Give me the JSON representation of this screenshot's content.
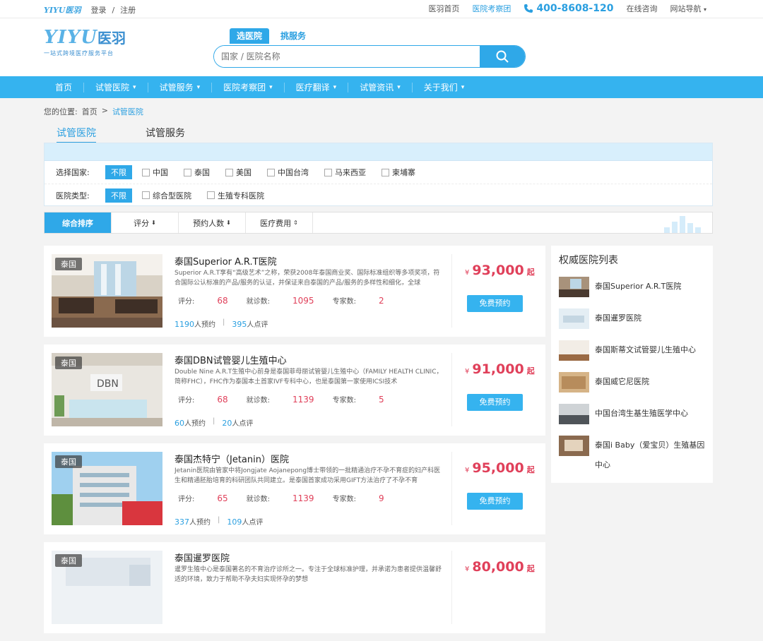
{
  "topbar": {
    "mini_logo": "YIYU医羽",
    "login": "登录",
    "sep": "/",
    "register": "注册",
    "links": [
      "医羽首页",
      "医院考察团"
    ],
    "phone": "400-8608-120",
    "online": "在线咨询",
    "sitenav": "网站导航"
  },
  "logo": {
    "en": "YIYU",
    "cn": "医羽",
    "sub": "一站式跨境医疗服务平台"
  },
  "search": {
    "tab_active": "选医院",
    "tab_other": "挑服务",
    "placeholder": "国家 / 医院名称"
  },
  "nav": [
    "首页",
    "试管医院",
    "试管服务",
    "医院考察团",
    "医疗翻译",
    "试管资讯",
    "关于我们"
  ],
  "breadcrumb": {
    "label": "您的位置:",
    "home": "首页",
    "arrow": ">",
    "current": "试管医院"
  },
  "page_tabs": [
    "试管医院",
    "试管服务"
  ],
  "filters": {
    "country_label": "选择国家:",
    "unlimited": "不限",
    "countries": [
      "中国",
      "泰国",
      "美国",
      "中国台湾",
      "马来西亚",
      "柬埔寨"
    ],
    "type_label": "医院类型:",
    "types": [
      "综合型医院",
      "生殖专科医院"
    ]
  },
  "sort": [
    "综合排序",
    "评分",
    "预约人数",
    "医疗费用"
  ],
  "hospitals": [
    {
      "tag": "泰国",
      "name": "泰国Superior A.R.T医院",
      "desc": "Superior A.R.T享有“高级艺术”之称，荣获2008年泰国商业奖、国际标准组织等多项奖项，符合国际公认标准的产品/服务的认证，并保证来自泰国的产品/服务的多样性和细化，全球",
      "score_label": "评分:",
      "score": "68",
      "visits_label": "就诊数:",
      "visits": "1095",
      "experts_label": "专家数:",
      "experts": "2",
      "bookings": "1190",
      "bookings_suffix": "人预约",
      "reviews": "395",
      "reviews_suffix": "人点评",
      "currency": "¥",
      "price": "93,000",
      "price_suffix": "起",
      "book_label": "免费预约"
    },
    {
      "tag": "泰国",
      "name": "泰国DBN试管婴儿生殖中心",
      "desc": "Double Nine A.R.T生殖中心前身是泰国菲母丽试管婴儿生殖中心（FAMILY HEALTH CLINIC，简称FHC），FHC作为泰国本土首家IVF专科中心，也是泰国第一家使用ICSI技术",
      "score_label": "评分:",
      "score": "68",
      "visits_label": "就诊数:",
      "visits": "1139",
      "experts_label": "专家数:",
      "experts": "5",
      "bookings": "60",
      "bookings_suffix": "人预约",
      "reviews": "20",
      "reviews_suffix": "人点评",
      "currency": "¥",
      "price": "91,000",
      "price_suffix": "起",
      "book_label": "免费预约"
    },
    {
      "tag": "泰国",
      "name": "泰国杰特宁（Jetanin）医院",
      "desc": "Jetanin医院由管家中将Jongjate Aojanepong博士带领的一批精通治疗不孕不育症的妇产科医生和精通胚胎培育的科研团队共同建立。是泰国首家成功采用GIFT方法治疗了不孕不育",
      "score_label": "评分:",
      "score": "65",
      "visits_label": "就诊数:",
      "visits": "1139",
      "experts_label": "专家数:",
      "experts": "9",
      "bookings": "337",
      "bookings_suffix": "人预约",
      "reviews": "109",
      "reviews_suffix": "人点评",
      "currency": "¥",
      "price": "95,000",
      "price_suffix": "起",
      "book_label": "免费预约"
    },
    {
      "tag": "泰国",
      "name": "泰国暹罗医院",
      "desc": "暹罗生殖中心是泰国著名的不育治疗诊所之一。专注于全球标准护理，并承诺为患者提供温馨舒适的环境，致力于帮助不孕夫妇实现怀孕的梦想",
      "score_label": "",
      "score": "",
      "visits_label": "",
      "visits": "",
      "experts_label": "",
      "experts": "",
      "bookings": "",
      "bookings_suffix": "",
      "reviews": "",
      "reviews_suffix": "",
      "currency": "¥",
      "price": "80,000",
      "price_suffix": "起",
      "book_label": ""
    }
  ],
  "sidebar": {
    "title": "权威医院列表",
    "items": [
      "泰国Superior A.R.T医院",
      "泰国暹罗医院",
      "泰国斯蒂文试管婴儿生殖中心",
      "泰国威它尼医院",
      "中国台湾生基生殖医学中心",
      "泰国i Baby（爱宝贝）生殖基因中心"
    ]
  },
  "colors": {
    "accent": "#2fa8e8",
    "nav": "#35b3ef",
    "price": "#e0405a"
  }
}
